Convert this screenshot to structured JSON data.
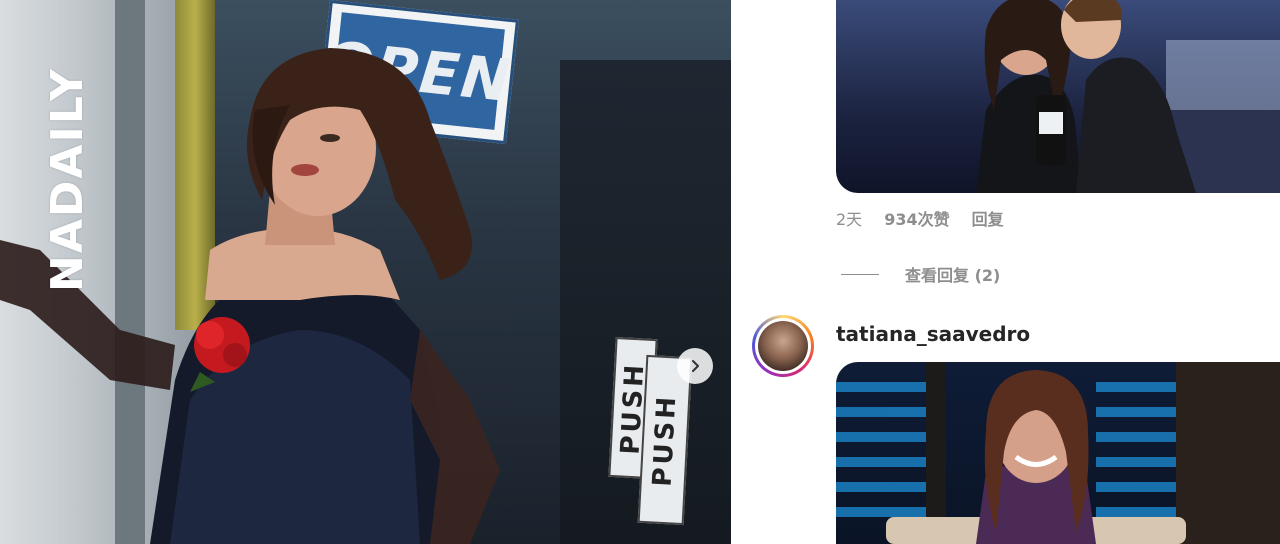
{
  "post_image": {
    "watermark": "NADAILY",
    "sign_open": "OPEN",
    "sign_push": "PUSH",
    "next_icon": "chevron-right-icon"
  },
  "comments": {
    "first": {
      "time": "2天",
      "likes": "934次赞",
      "reply_label": "回复",
      "view_replies": "查看回复 (2)"
    },
    "second": {
      "username": "tatiana_saavedro"
    }
  },
  "colors": {
    "muted_text": "#8e8e8e",
    "username_text": "#262626",
    "story_ring": [
      "#feda75",
      "#fa7e1e",
      "#d62976",
      "#962fbf",
      "#4f5bd5"
    ]
  }
}
